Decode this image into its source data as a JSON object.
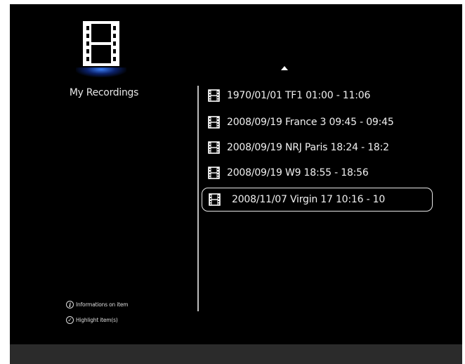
{
  "sidebar": {
    "section_icon": "film-icon",
    "section_title": "My Recordings",
    "legend": [
      {
        "icon": "info-icon",
        "glyph": "i",
        "label": "Informations on item"
      },
      {
        "icon": "check-icon",
        "glyph": "✓",
        "label": "Highlight item(s)"
      }
    ]
  },
  "list": {
    "scroll_indicator": "up-arrow-icon",
    "items": [
      {
        "label": "1970/01/01 TF1 01:00 - 11:06",
        "selected": false
      },
      {
        "label": "2008/09/19 France 3 09:45 - 09:45",
        "selected": false
      },
      {
        "label": "2008/09/19 NRJ Paris 18:24 - 18:2",
        "selected": false
      },
      {
        "label": "2008/09/19 W9 18:55 - 18:56",
        "selected": false
      },
      {
        "label": "2008/11/07 Virgin 17 10:16 - 10",
        "selected": true
      }
    ]
  },
  "colors": {
    "background": "#000000",
    "text": "#f0f0f0",
    "glow": "#3c82ff",
    "bottom_band": "#2b2b2b"
  }
}
